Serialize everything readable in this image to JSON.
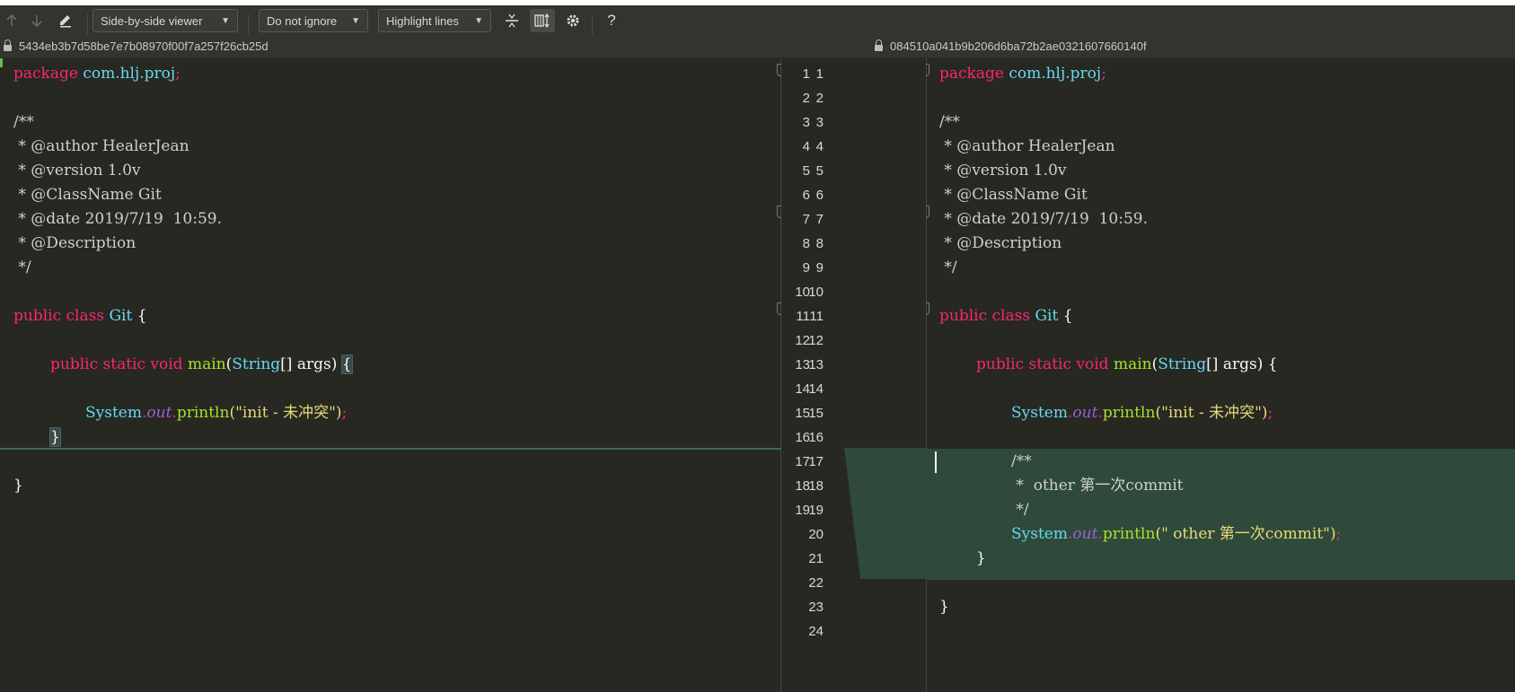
{
  "toolbar": {
    "viewer_label": "Side-by-side viewer",
    "ignore_label": "Do not ignore",
    "highlight_label": "Highlight lines",
    "help_label": "?"
  },
  "left_hash": "5434eb3b7d58be7e7b08970f00f7a257f26cb25d",
  "right_hash": "084510a041b9b206d6ba72b2ae0321607660140f",
  "colors": {
    "background": "#272822",
    "diff_insert": "#2f4a3a",
    "keyword": "#f92672",
    "type": "#66d9ef",
    "function": "#a6e22e",
    "string": "#e6db74"
  },
  "left": {
    "line_numbers": [
      "1",
      "2",
      "3",
      "4",
      "5",
      "6",
      "7",
      "8",
      "9",
      "10",
      "11",
      "12",
      "13",
      "14",
      "15",
      "16",
      "17",
      "18",
      "19"
    ],
    "package_kw": "package",
    "package_name": "com.hlj.proj",
    "semi": ";",
    "doc_open": "/**",
    "author": " * @author HealerJean",
    "version": " * @version 1.0v",
    "classname": " * @ClassName Git",
    "date": " * @date 2019/7/19  10:59.",
    "description": " * @Description",
    "doc_close": " */",
    "class_public": "public",
    "class_kw": "class",
    "class_name": "Git",
    "class_open": "{",
    "main_public": "public",
    "main_static": "static",
    "main_void": "void",
    "main_name": "main",
    "main_paren": "(",
    "main_type": "String",
    "main_args": "[] args)",
    "main_open": "{",
    "print_system": "System",
    "print_dot1": ".",
    "print_out": "out",
    "print_dot2": ".",
    "print_fn": "println",
    "print_arg": "(\"init - 未冲突\")",
    "inner_close": "}",
    "outer_close": "}"
  },
  "right": {
    "line_numbers": [
      "1",
      "2",
      "3",
      "4",
      "5",
      "6",
      "7",
      "8",
      "9",
      "10",
      "11",
      "12",
      "13",
      "14",
      "15",
      "16",
      "17",
      "18",
      "19",
      "20",
      "21",
      "22",
      "23",
      "24"
    ],
    "package_kw": "package",
    "package_name": "com.hlj.proj",
    "semi": ";",
    "doc_open": "/**",
    "author": " * @author HealerJean",
    "version": " * @version 1.0v",
    "classname": " * @ClassName Git",
    "date": " * @date 2019/7/19  10:59.",
    "description": " * @Description",
    "doc_close": " */",
    "class_public": "public",
    "class_kw": "class",
    "class_name": "Git",
    "class_open": "{",
    "main_public": "public",
    "main_static": "static",
    "main_void": "void",
    "main_name": "main",
    "main_paren": "(",
    "main_type": "String",
    "main_args": "[] args)",
    "main_open": "{",
    "print_system": "System",
    "print_dot1": ".",
    "print_out": "out",
    "print_dot2": ".",
    "print_fn": "println",
    "print_arg": "(\"init - 未冲突\")",
    "c_open": "/**",
    "c_text": " *  other 第一次commit",
    "c_close": " */",
    "print2_system": "System",
    "print2_dot1": ".",
    "print2_out": "out",
    "print2_dot2": ".",
    "print2_fn": "println",
    "print2_arg": "(\" other 第一次commit\")",
    "inner_close": "}",
    "outer_close": "}"
  }
}
